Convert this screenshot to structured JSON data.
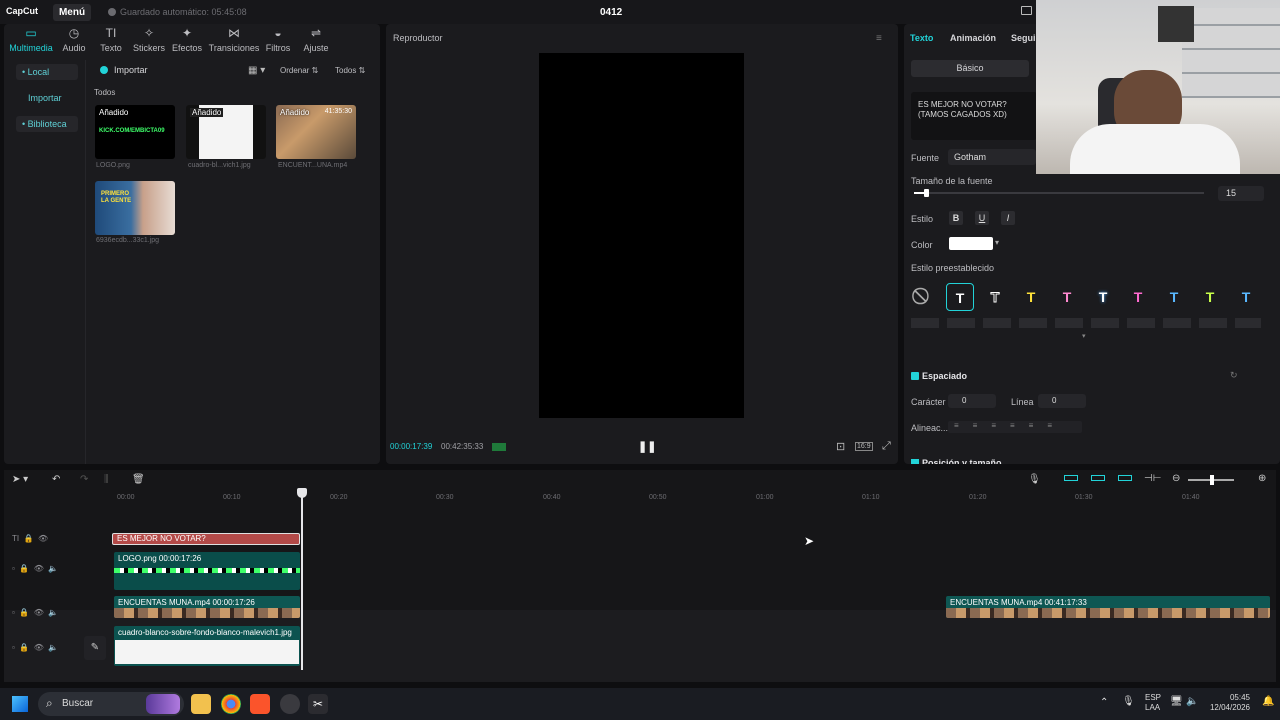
{
  "titlebar": {
    "logo": "CapCut",
    "menu": "Menú",
    "autosave": "Guardado automático: 05:45:08",
    "project": "0412"
  },
  "toolbar": {
    "tabs": [
      {
        "label": "Multimedia",
        "icon": "media-icon"
      },
      {
        "label": "Audio",
        "icon": "audio-icon"
      },
      {
        "label": "Texto",
        "icon": "text-icon"
      },
      {
        "label": "Stickers",
        "icon": "sticker-icon"
      },
      {
        "label": "Efectos",
        "icon": "effects-icon"
      },
      {
        "label": "Transiciones",
        "icon": "transitions-icon"
      },
      {
        "label": "Filtros",
        "icon": "filters-icon"
      },
      {
        "label": "Ajuste",
        "icon": "adjust-icon"
      }
    ]
  },
  "media": {
    "nav": [
      "• Local",
      "Importar",
      "• Biblioteca"
    ],
    "import": "Importar",
    "sort": "Ordenar",
    "filter": "Todos",
    "section": "Todos",
    "items": [
      {
        "name": "LOGO.png",
        "badge": "Añadido",
        "text": "KICK.COM/EMBICTA09"
      },
      {
        "name": "cuadro-bl...vich1.jpg",
        "badge": "Añadido"
      },
      {
        "name": "ENCUENT...UNA.mp4",
        "badge": "Añadido",
        "duration": "41:35:30"
      },
      {
        "name": "6936ecdb...33c1.jpg",
        "text": "PRIMERO LA GENTE"
      }
    ]
  },
  "player": {
    "title": "Reproductor",
    "current": "00:00:17:39",
    "total": "00:42:35:33",
    "ratio": "16:9"
  },
  "props": {
    "tabs": [
      "Texto",
      "Animación",
      "Seguim"
    ],
    "subtab": "Básico",
    "text_line1": "ES MEJOR NO VOTAR?",
    "text_line2": "(TAMOS CAGADOS XD)",
    "font_label": "Fuente",
    "font_value": "Gotham",
    "size_label": "Tamaño de la fuente",
    "size_value": "15",
    "size_fraction": 0.04,
    "style_label": "Estilo",
    "color_label": "Color",
    "color_value": "#ffffff",
    "preset_label": "Estilo preestablecido",
    "spacing_label": "Espaciado",
    "char_label": "Carácter",
    "char_value": "0",
    "line_label": "Línea",
    "line_value": "0",
    "align_label": "Alineac...",
    "position_label": "Posición y tamaño"
  },
  "timeline": {
    "ticks": [
      "00:00",
      "00:10",
      "00:20",
      "00:30",
      "00:40",
      "00:50",
      "01:00",
      "01:10",
      "01:20",
      "01:30",
      "01:40"
    ],
    "clips": {
      "text": "ES MEJOR NO VOTAR?",
      "logo": "LOGO.png  00:00:17:26",
      "video1": "ENCUENTAS MUNA.mp4  00:00:17:26",
      "video2": "ENCUENTAS MUNA.mp4  00:41:17:33",
      "image": "cuadro-blanco-sobre-fondo-blanco-malevich1.jpg"
    }
  },
  "taskbar": {
    "search": "Buscar",
    "lang1": "ESP",
    "lang2": "LAA",
    "time": "05:45",
    "date": "12/04/2026"
  }
}
